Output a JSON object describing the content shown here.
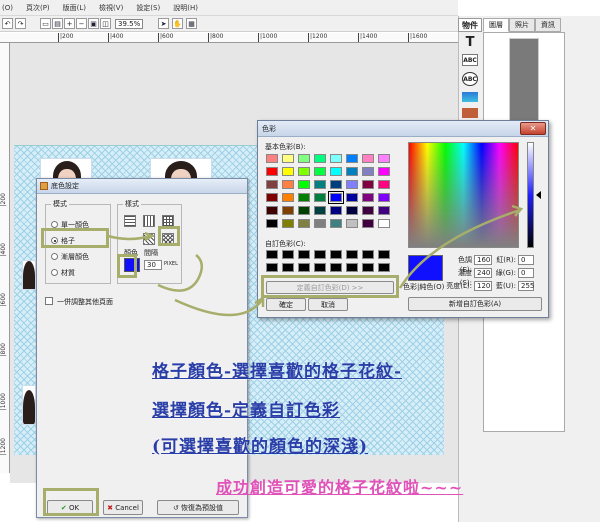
{
  "menubar": {
    "items": [
      "(O)",
      "頁次(P)",
      "版面(L)",
      "檢視(V)",
      "設定(S)",
      "說明(H)"
    ]
  },
  "toolbar": {
    "zoom": "39.5%"
  },
  "ruler": {
    "h_ticks": [
      "|200",
      "|400",
      "|600",
      "|800",
      "|1000",
      "|1200",
      "|1400",
      "|1600",
      "|1800",
      "|2000"
    ],
    "v_ticks": [
      "|200",
      "|400",
      "|600",
      "|800",
      "|1000",
      "|1200",
      "|1400"
    ]
  },
  "right_panel": {
    "objects_tab": "物件",
    "tabs": [
      "圖層",
      "照片",
      "資訊"
    ]
  },
  "bg_dialog": {
    "title": "底色設定",
    "mode_group": "模式",
    "modes": [
      "單一顏色",
      "格子",
      "漸層顏色",
      "材質"
    ],
    "selected_mode": "格子",
    "style_group": "樣式",
    "color_label": "顏色",
    "spacing_label": "間隔",
    "spacing_value": "30",
    "spacing_unit": "PIXEL",
    "apply_all": "一併調整其他頁面",
    "ok": "OK",
    "cancel": "Cancel",
    "restore": "恢復為預設值",
    "selected_color": "#1010ff"
  },
  "color_dialog": {
    "title": "色彩",
    "basic_label": "基本色彩(B):",
    "custom_label": "自訂色彩(C):",
    "define_button": "定義自訂色彩(D) >>",
    "ok": "確定",
    "cancel": "取消",
    "color_solid_label": "色彩|純色(O)",
    "add_custom": "新增自訂色彩(A)",
    "hue_label": "色調(E):",
    "hue": "160",
    "sat_label": "濃度(S):",
    "sat": "240",
    "lum_label": "亮度(L):",
    "lum": "120",
    "red_label": "紅(R):",
    "red": "0",
    "green_label": "綠(G):",
    "green": "0",
    "blue_label": "藍(U):",
    "blue": "255",
    "basic_colors": [
      "#ff8080",
      "#ffff80",
      "#80ff80",
      "#00ff80",
      "#80ffff",
      "#0080ff",
      "#ff80c0",
      "#ff80ff",
      "#ff0000",
      "#ffff00",
      "#80ff00",
      "#00ff40",
      "#00ffff",
      "#0080c0",
      "#8080c0",
      "#ff00ff",
      "#804040",
      "#ff8040",
      "#00ff00",
      "#008080",
      "#004080",
      "#8080ff",
      "#800040",
      "#ff0080",
      "#800000",
      "#ff8000",
      "#008000",
      "#008040",
      "#0000ff",
      "#0000a0",
      "#800080",
      "#8000ff",
      "#400000",
      "#804000",
      "#004000",
      "#004040",
      "#000080",
      "#000040",
      "#400040",
      "#400080",
      "#000000",
      "#808000",
      "#808040",
      "#808080",
      "#408080",
      "#c0c0c0",
      "#400040",
      "#ffffff"
    ],
    "custom_colors": [
      "#000000",
      "#000000",
      "#000000",
      "#000000",
      "#000000",
      "#000000",
      "#000000",
      "#000000",
      "#000000",
      "#000000",
      "#000000",
      "#000000",
      "#000000",
      "#000000",
      "#000000",
      "#000000"
    ]
  },
  "annotation": {
    "line1": "格子顏色-選擇喜歡的格子花紋-",
    "line2": "選擇顏色-定義自訂色彩",
    "line3": "(可選擇喜歡的顏色的深淺)",
    "line4": "成功創造可愛的格子花紋啦~~~"
  }
}
